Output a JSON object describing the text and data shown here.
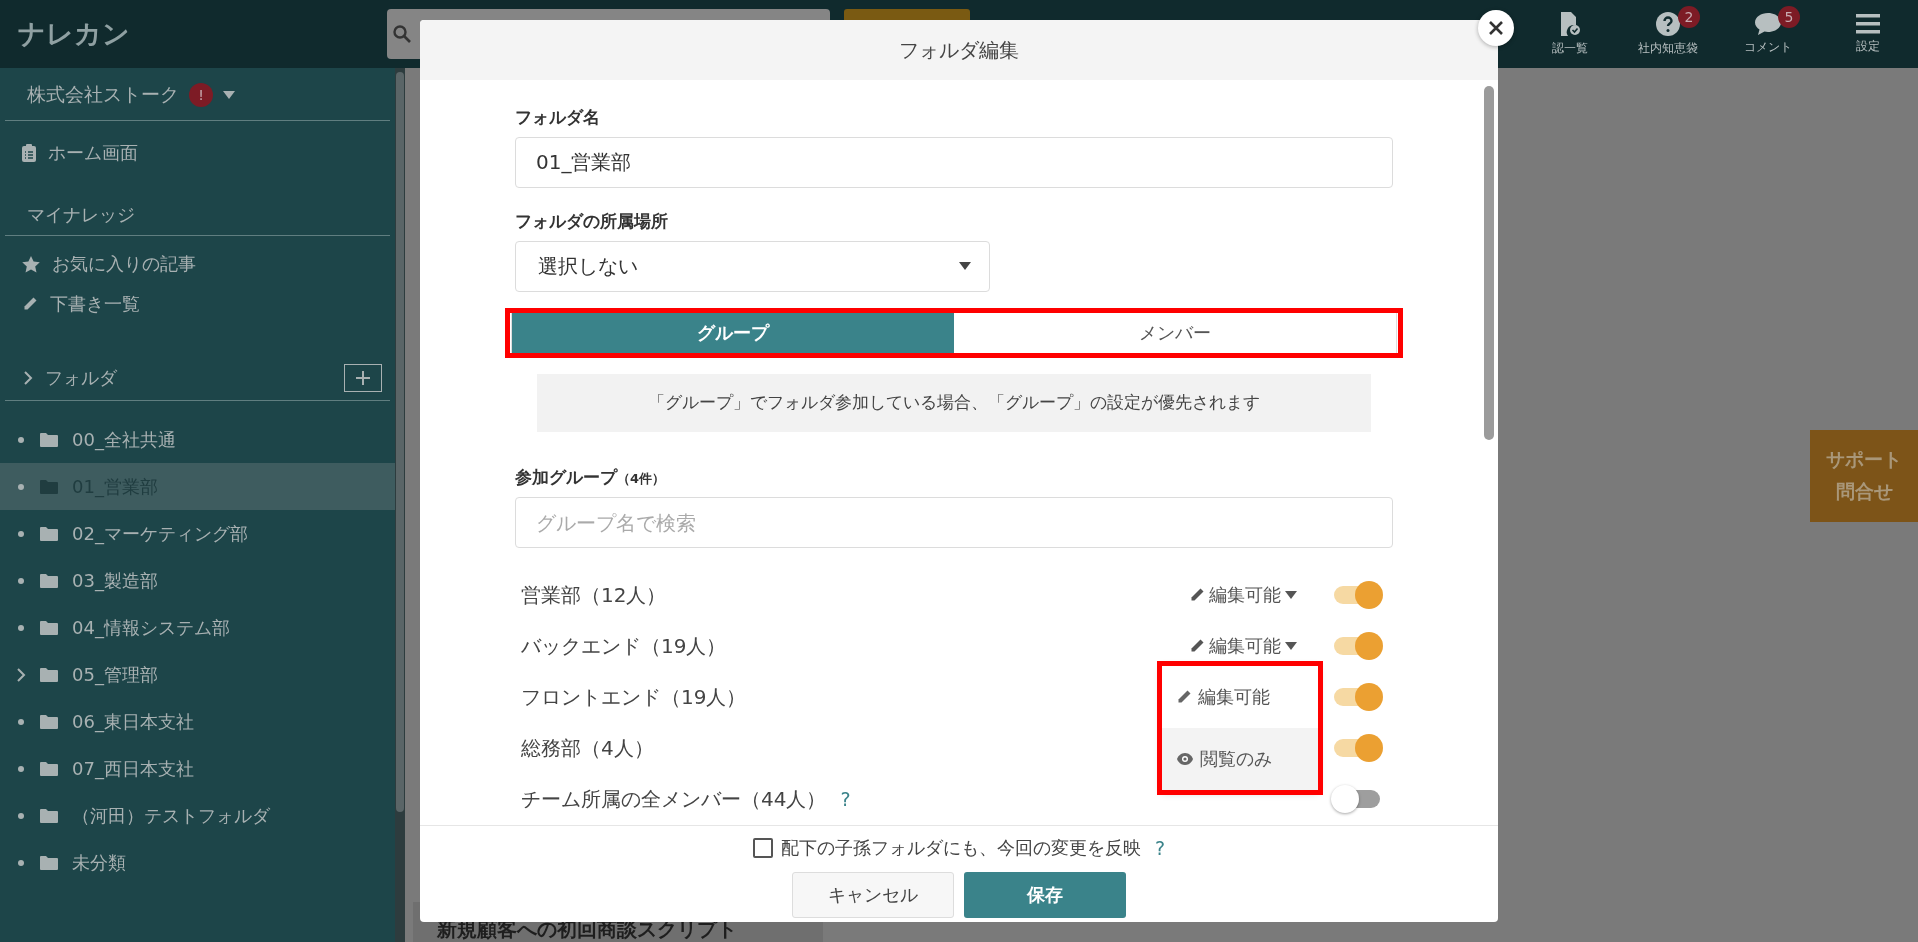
{
  "topbar": {
    "logo": "ナレカン",
    "nav": [
      {
        "label": "認一覧",
        "kind": "approval"
      },
      {
        "label": "社内知恵袋",
        "kind": "question",
        "badge": "2"
      },
      {
        "label": "コメント",
        "kind": "comment",
        "badge": "5"
      },
      {
        "label": "設定",
        "kind": "menu"
      }
    ]
  },
  "sidebar": {
    "company": "株式会社ストーク",
    "company_alert": "!",
    "home": "ホーム画面",
    "section": "マイナレッジ",
    "links": [
      {
        "label": "お気に入りの記事",
        "kind": "star"
      },
      {
        "label": "下書き一覧",
        "kind": "pencil"
      }
    ],
    "folder_heading": "フォルダ",
    "folders": [
      {
        "label": "00_全社共通",
        "selected": false,
        "expandable": false
      },
      {
        "label": "01_営業部",
        "selected": true,
        "expandable": false
      },
      {
        "label": "02_マーケティング部",
        "selected": false,
        "expandable": false
      },
      {
        "label": "03_製造部",
        "selected": false,
        "expandable": false
      },
      {
        "label": "04_情報システム部",
        "selected": false,
        "expandable": false
      },
      {
        "label": "05_管理部",
        "selected": false,
        "expandable": true
      },
      {
        "label": "06_東日本支社",
        "selected": false,
        "expandable": false
      },
      {
        "label": "07_西日本支社",
        "selected": false,
        "expandable": false
      },
      {
        "label": "（河田）テストフォルダ",
        "selected": false,
        "expandable": false
      },
      {
        "label": "未分類",
        "selected": false,
        "expandable": false
      }
    ]
  },
  "main": {
    "card_title": "新規顧客への初回商談スクリプト"
  },
  "support": {
    "lines": [
      "サポート",
      "問合せ"
    ]
  },
  "dialog": {
    "title": "フォルダ編集",
    "name_label": "フォルダ名",
    "name_value": "01_営業部",
    "location_label": "フォルダの所属場所",
    "location_value": "選択しない",
    "tabs": [
      {
        "label": "グループ",
        "selected": true
      },
      {
        "label": "メンバー",
        "selected": false
      }
    ],
    "tabs_highlighted": true,
    "notice": "「グループ」でフォルダ参加している場合、「グループ」の設定が優先されます",
    "groups_label": "参加グループ",
    "groups_count": "（4件）",
    "search_placeholder": "グループ名で検索",
    "groups": [
      {
        "name": "営業部（12人）",
        "permission": "編集可能",
        "on": true
      },
      {
        "name": "バックエンド（19人）",
        "permission": "編集可能",
        "on": true
      },
      {
        "name": "フロントエンド（19人）",
        "on": true
      },
      {
        "name": "総務部（4人）",
        "on": true
      },
      {
        "name": "チーム所属の全メンバー（44人）",
        "help": "?",
        "on": false
      }
    ],
    "permission_menu": {
      "highlighted": true,
      "items": [
        {
          "label": "編集可能",
          "kind": "edit",
          "selected": false
        },
        {
          "label": "閲覧のみ",
          "kind": "view",
          "selected": true
        }
      ]
    },
    "propagate": {
      "label": "配下の子孫フォルダにも、今回の変更を反映",
      "checked": false,
      "help": "?"
    },
    "cancel": "キャンセル",
    "save": "保存"
  }
}
